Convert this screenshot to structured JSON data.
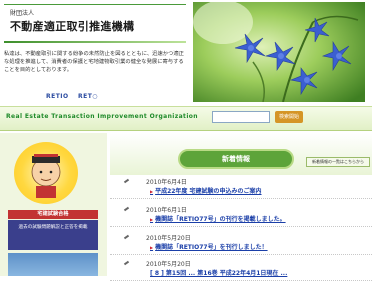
{
  "header": {
    "org_prefix": "財団法人",
    "org_name": "不動産適正取引推進機構"
  },
  "intro": {
    "text": "私達は、不動産取引に関する紛争の未然防止を図るとともに、迅速かつ適正な処理を推進して、消費者の保護と宅地建物取引業の健全な発展に寄与することを目的としております。"
  },
  "retio_links": {
    "en": "RETIO",
    "jp": "RET○"
  },
  "tagline": "Real Estate Transaction Improvement Organization",
  "search": {
    "button_label": "検索開始",
    "value": "",
    "placeholder": ""
  },
  "left": {
    "badge_label": "宅建試験合格",
    "promo_text": "過去の試験問題解説と正答を掲載"
  },
  "news": {
    "title": "新着情報",
    "more_label": "新着情報の一覧はこちらから",
    "items": [
      {
        "date": "2010年6月4日",
        "title": "平成22年度 宅建試験の申込みのご案内"
      },
      {
        "date": "2010年6月1日",
        "title": "機関誌「RETIO77号」の刊行を掲載しました。"
      },
      {
        "date": "2010年5月20日",
        "title": "機関誌「RETIO77号」を刊行しました！"
      },
      {
        "date": "2010年5月20日",
        "title": "[ 8 ] 第15回 ... 第16巻 平成22年4月1日現在 ..."
      }
    ]
  },
  "colors": {
    "brand_green": "#3d8f2c",
    "link_blue": "#1b3fa8",
    "accent_orange": "#d59526"
  }
}
